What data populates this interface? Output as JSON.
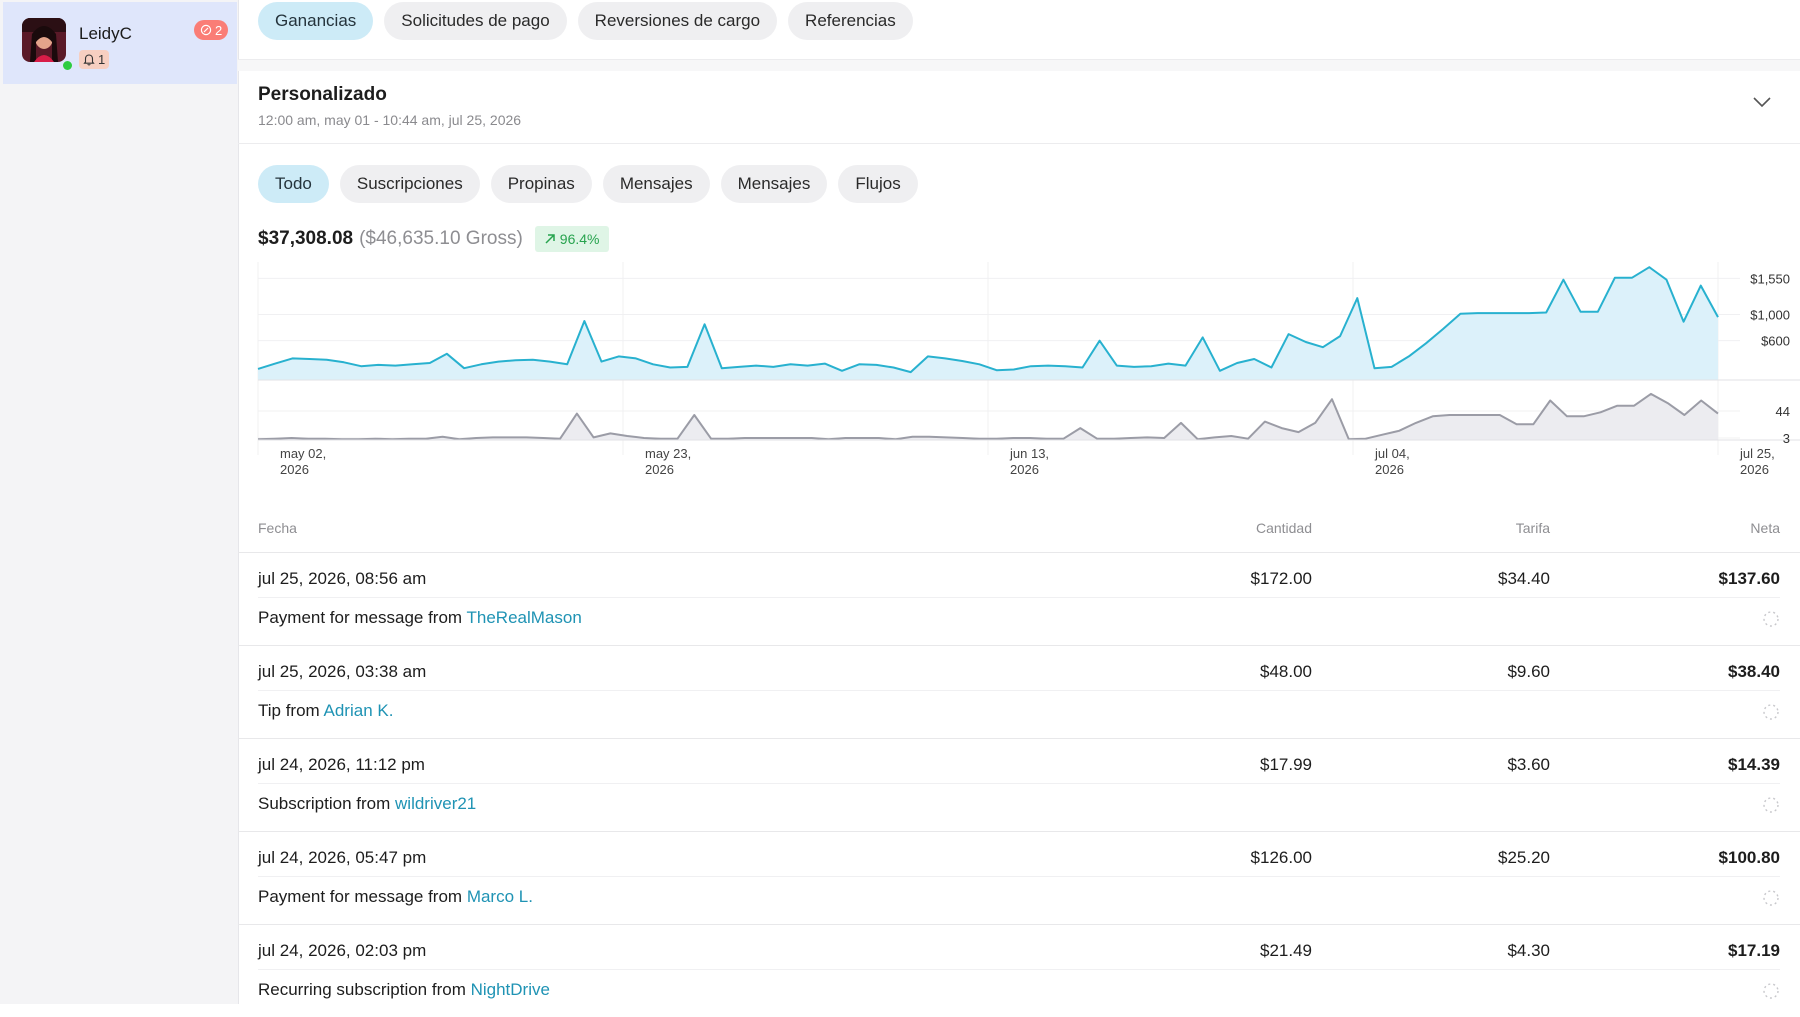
{
  "account": {
    "name": "LeidyC",
    "notifications": "1",
    "messages": "2"
  },
  "top_tabs": [
    "Ganancias",
    "Solicitudes de pago",
    "Reversiones de cargo",
    "Referencias"
  ],
  "period": {
    "title": "Personalizado",
    "range": "12:00 am, may 01 - 10:44 am, jul 25, 2026"
  },
  "filter_tabs": [
    "Todo",
    "Suscripciones",
    "Propinas",
    "Mensajes",
    "Mensajes",
    "Flujos"
  ],
  "summary": {
    "net": "$37,308.08",
    "gross": "($46,635.10 Gross)",
    "growth": "96.4%"
  },
  "colors": {
    "accent": "#1f93b4",
    "earnings_line": "#28b1cf",
    "count_line": "#9b9ca6",
    "positive": "#27a34e"
  },
  "chart_data": {
    "type": "line",
    "x_ticks": [
      {
        "l1": "may 02,",
        "l2": "2026"
      },
      {
        "l1": "may 23,",
        "l2": "2026"
      },
      {
        "l1": "jun 13,",
        "l2": "2026"
      },
      {
        "l1": "jul 04,",
        "l2": "2026"
      },
      {
        "l1": "jul 25,",
        "l2": "2026"
      }
    ],
    "series": [
      {
        "ticks": [
          "$1,550",
          "$1,000",
          "$600"
        ],
        "tick_values": [
          1550,
          1000,
          600
        ],
        "ylim": [
          0,
          1800
        ],
        "values": [
          170,
          250,
          330,
          320,
          310,
          270,
          210,
          230,
          220,
          240,
          260,
          400,
          180,
          240,
          280,
          300,
          310,
          280,
          240,
          900,
          280,
          360,
          330,
          240,
          190,
          200,
          850,
          180,
          200,
          220,
          200,
          240,
          220,
          250,
          140,
          240,
          230,
          190,
          120,
          360,
          330,
          290,
          240,
          150,
          160,
          210,
          220,
          210,
          190,
          600,
          220,
          200,
          210,
          250,
          220,
          650,
          140,
          260,
          320,
          190,
          700,
          580,
          500,
          670,
          1250,
          180,
          200,
          360,
          560,
          780,
          1010,
          1020,
          1020,
          1020,
          1020,
          1030,
          1530,
          1040,
          1040,
          1560,
          1560,
          1720,
          1530,
          890,
          1440,
          960
        ]
      },
      {
        "ticks": [
          "44",
          "3"
        ],
        "tick_values": [
          44,
          3
        ],
        "ylim": [
          0,
          85
        ],
        "values": [
          1,
          2,
          3,
          2,
          2,
          1,
          1,
          2,
          1,
          2,
          2,
          5,
          1,
          3,
          4,
          4,
          4,
          3,
          2,
          40,
          4,
          10,
          6,
          3,
          2,
          2,
          38,
          2,
          2,
          3,
          3,
          3,
          3,
          3,
          1,
          3,
          3,
          3,
          1,
          5,
          5,
          4,
          3,
          2,
          2,
          3,
          3,
          2,
          2,
          18,
          2,
          2,
          3,
          4,
          3,
          26,
          1,
          4,
          6,
          2,
          28,
          18,
          12,
          26,
          62,
          1,
          2,
          8,
          14,
          26,
          36,
          38,
          38,
          38,
          38,
          24,
          24,
          60,
          36,
          36,
          42,
          52,
          52,
          70,
          56,
          38,
          60,
          40
        ]
      }
    ]
  },
  "table": {
    "headers": {
      "date": "Fecha",
      "amount": "Cantidad",
      "fee": "Tarifa",
      "net": "Neta"
    },
    "rows": [
      {
        "date": "jul 25, 2026, 08:56 am",
        "amount": "$172.00",
        "fee": "$34.40",
        "net": "$137.60",
        "desc": "Payment for message from",
        "user": "TheRealMason"
      },
      {
        "date": "jul 25, 2026, 03:38 am",
        "amount": "$48.00",
        "fee": "$9.60",
        "net": "$38.40",
        "desc": "Tip from",
        "user": "Adrian K."
      },
      {
        "date": "jul 24, 2026, 11:12 pm",
        "amount": "$17.99",
        "fee": "$3.60",
        "net": "$14.39",
        "desc": "Subscription from",
        "user": "wildriver21"
      },
      {
        "date": "jul 24, 2026, 05:47 pm",
        "amount": "$126.00",
        "fee": "$25.20",
        "net": "$100.80",
        "desc": "Payment for message from",
        "user": "Marco L."
      },
      {
        "date": "jul 24, 2026, 02:03 pm",
        "amount": "$21.49",
        "fee": "$4.30",
        "net": "$17.19",
        "desc": "Recurring subscription from",
        "user": "NightDrive"
      }
    ]
  }
}
